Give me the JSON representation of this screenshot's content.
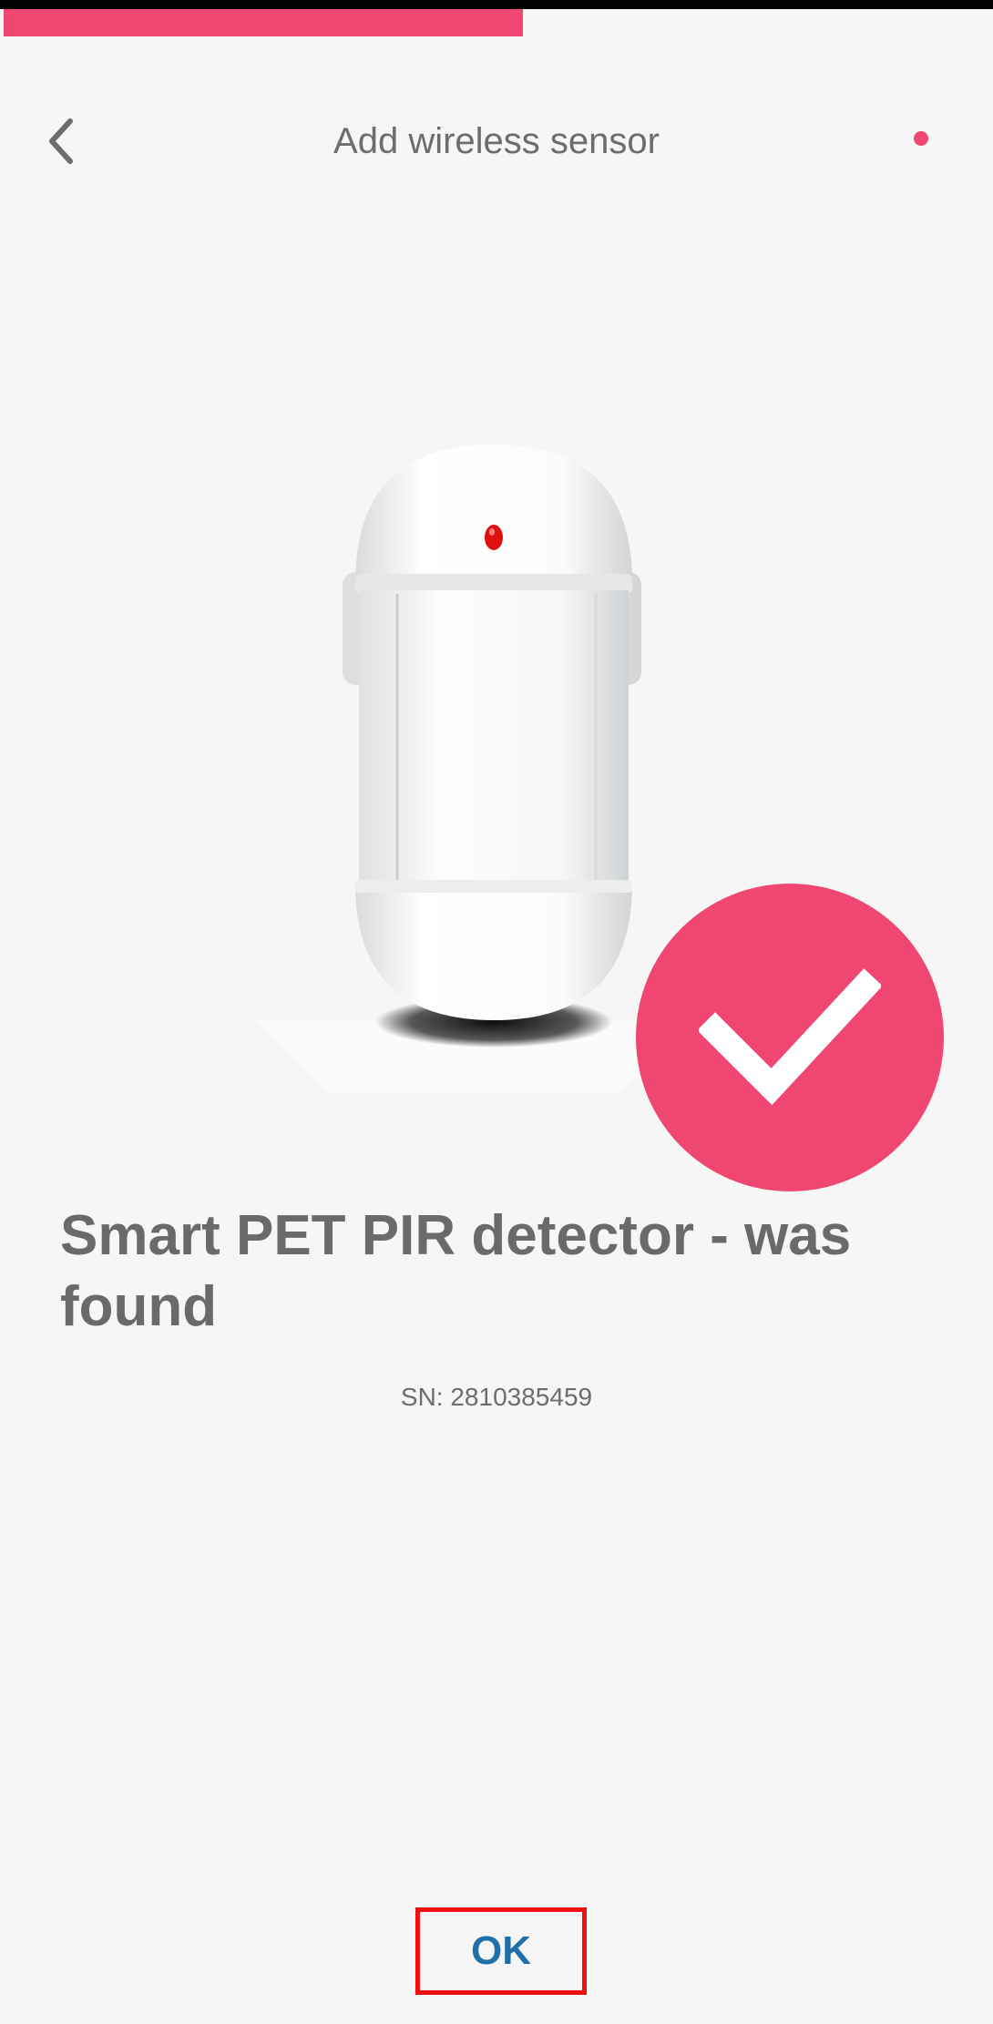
{
  "progress": {
    "fraction": 0.525,
    "color": "#ef4772"
  },
  "header": {
    "back_icon": "chevron-left-icon",
    "title": "Add wireless sensor",
    "status_dot_color": "#ef4772"
  },
  "device": {
    "image_icon": "pir-motion-sensor-illustration",
    "found_icon": "checkmark-icon",
    "badge_color": "#ef4772"
  },
  "result": {
    "title": "Smart PET PIR detector - was found",
    "serial": "SN: 2810385459"
  },
  "actions": {
    "ok_label": "OK",
    "ok_color": "#1f6fa8"
  }
}
